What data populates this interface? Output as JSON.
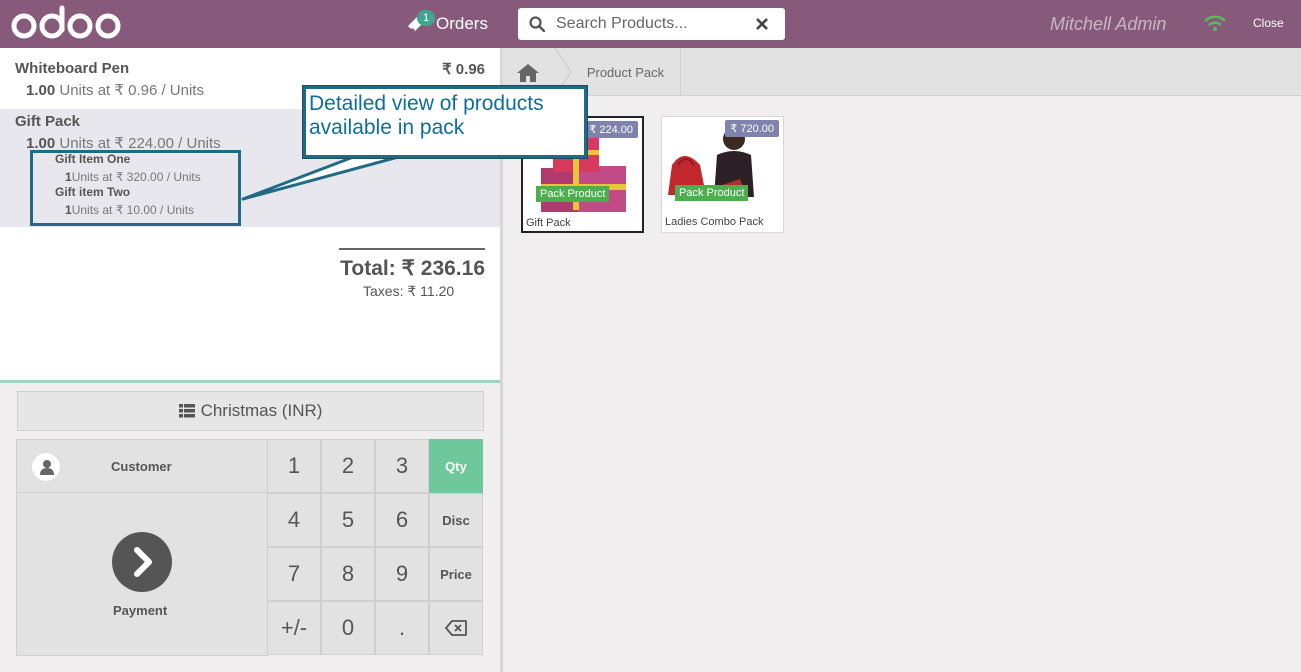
{
  "header": {
    "orders_label": "Orders",
    "orders_count": "1",
    "search_placeholder": "Search Products...",
    "user_name": "Mitchell Admin",
    "close_label": "Close"
  },
  "order": {
    "lines": [
      {
        "name": "Whiteboard Pen",
        "price": "₹ 0.96",
        "qty": "1.00",
        "unit_info": "Units at ₹ 0.96 / Units"
      },
      {
        "name": "Gift Pack",
        "qty": "1.00",
        "unit_info": "Units at ₹ 224.00 / Units",
        "pack_items": [
          {
            "name": "Gift Item One",
            "qty": "1",
            "unit_info": "Units at ₹ 320.00 / Units"
          },
          {
            "name": "Gift item Two",
            "qty": "1",
            "unit_info": "Units at ₹ 10.00 / Units"
          }
        ]
      }
    ],
    "total": "Total: ₹ 236.16",
    "taxes": "Taxes: ₹ 11.20"
  },
  "pricelist_label": "Christmas (INR)",
  "actionpad": {
    "customer_label": "Customer",
    "payment_label": "Payment"
  },
  "numpad": {
    "keys": [
      "1",
      "2",
      "3",
      "4",
      "5",
      "6",
      "7",
      "8",
      "9",
      "+/-",
      "0",
      "."
    ],
    "modes": [
      "Qty",
      "Disc",
      "Price"
    ],
    "active_mode": "Qty"
  },
  "breadcrumb": {
    "category": "Product Pack"
  },
  "products": [
    {
      "name": "Gift Pack",
      "price": "₹ 224.00",
      "tag": "Pack Product",
      "selected": true
    },
    {
      "name": "Ladies Combo Pack",
      "price": "₹ 720.00",
      "tag": "Pack Product",
      "selected": false
    }
  ],
  "annotation": {
    "text": "Detailed view of  products available in pack"
  },
  "colors": {
    "header": "#875a7b",
    "active_mode": "#6ec89b",
    "callout_border": "#1f6b85",
    "callout_text": "#0e6e9a",
    "pack_tag": "#4cae4c"
  }
}
